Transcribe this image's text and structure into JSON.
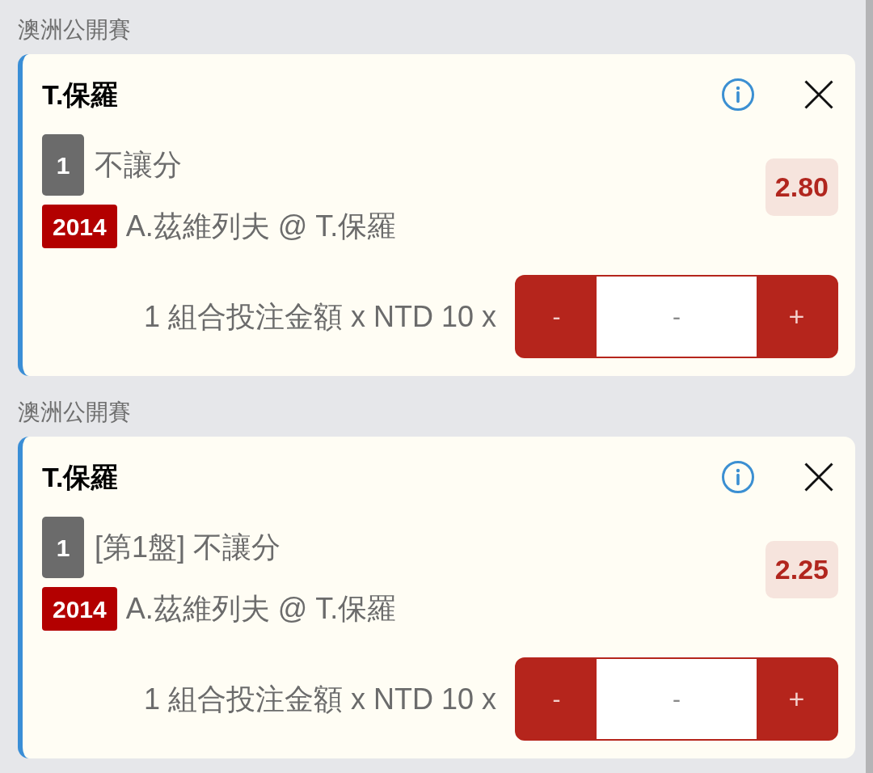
{
  "sections": [
    {
      "league": "澳洲公開賽",
      "bet": {
        "title": "T.保羅",
        "leg_number": "1",
        "market": "不讓分",
        "event_code": "2014",
        "match": "A.茲維列夫 @ T.保羅",
        "odds": "2.80",
        "stake_label": "1 組合投注金額 x NTD 10 x",
        "stepper": {
          "decrement": "-",
          "placeholder": "-",
          "increment": "+"
        }
      }
    },
    {
      "league": "澳洲公開賽",
      "bet": {
        "title": "T.保羅",
        "leg_number": "1",
        "market": "[第1盤] 不讓分",
        "event_code": "2014",
        "match": "A.茲維列夫 @ T.保羅",
        "odds": "2.25",
        "stake_label": "1 組合投注金額 x NTD 10 x",
        "stepper": {
          "decrement": "-",
          "placeholder": "-",
          "increment": "+"
        }
      }
    }
  ]
}
